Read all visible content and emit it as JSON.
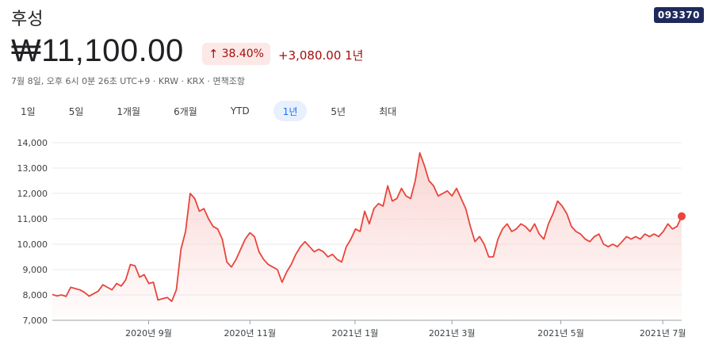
{
  "header": {
    "title": "후성",
    "ticker": "093370",
    "price": "₩11,100.00",
    "change_pct": "38.40%",
    "change_abs": "+3,080.00 1년",
    "meta": "7월 8일, 오후 6시 0분 26초 UTC+9 · KRW · KRX · 면책조항"
  },
  "ranges": [
    {
      "label": "1일",
      "active": false
    },
    {
      "label": "5일",
      "active": false
    },
    {
      "label": "1개월",
      "active": false
    },
    {
      "label": "6개월",
      "active": false
    },
    {
      "label": "YTD",
      "active": false
    },
    {
      "label": "1년",
      "active": true
    },
    {
      "label": "5년",
      "active": false
    },
    {
      "label": "최대",
      "active": false
    }
  ],
  "colors": {
    "line": "#e8453c",
    "fill": "#f9d3d0",
    "grid": "#e8eaed"
  },
  "chart_data": {
    "type": "area",
    "ylim": [
      7000,
      14000
    ],
    "yticks": [
      "14,000",
      "13,000",
      "12,000",
      "11,000",
      "10,000",
      "9,000",
      "8,000",
      "7,000"
    ],
    "ytick_values": [
      14000,
      13000,
      12000,
      11000,
      10000,
      9000,
      8000,
      7000
    ],
    "xticks": [
      {
        "label": "2020년 9월",
        "pos": 0.153
      },
      {
        "label": "2020년 11월",
        "pos": 0.314
      },
      {
        "label": "2021년 1월",
        "pos": 0.481
      },
      {
        "label": "2021년 3월",
        "pos": 0.635
      },
      {
        "label": "2021년 5월",
        "pos": 0.808
      },
      {
        "label": "2021년 7월",
        "pos": 0.97
      }
    ],
    "values": [
      8020,
      7960,
      8000,
      7940,
      8300,
      8250,
      8200,
      8100,
      7950,
      8050,
      8150,
      8400,
      8300,
      8200,
      8450,
      8350,
      8600,
      9200,
      9150,
      8700,
      8800,
      8450,
      8500,
      7800,
      7850,
      7900,
      7750,
      8200,
      9800,
      10500,
      12000,
      11800,
      11300,
      11400,
      11000,
      10700,
      10600,
      10200,
      9300,
      9100,
      9400,
      9800,
      10200,
      10450,
      10300,
      9700,
      9400,
      9200,
      9100,
      9000,
      8500,
      8900,
      9200,
      9600,
      9900,
      10100,
      9900,
      9700,
      9800,
      9700,
      9500,
      9600,
      9400,
      9300,
      9900,
      10200,
      10600,
      10500,
      11300,
      10800,
      11400,
      11600,
      11500,
      12300,
      11700,
      11800,
      12200,
      11900,
      11800,
      12500,
      13600,
      13100,
      12500,
      12300,
      11900,
      12000,
      12100,
      11900,
      12200,
      11800,
      11400,
      10700,
      10100,
      10300,
      10000,
      9500,
      9500,
      10200,
      10600,
      10800,
      10500,
      10600,
      10800,
      10700,
      10500,
      10800,
      10400,
      10200,
      10800,
      11200,
      11700,
      11500,
      11200,
      10700,
      10500,
      10400,
      10200,
      10100,
      10300,
      10400,
      10000,
      9900,
      10000,
      9900,
      10100,
      10300,
      10200,
      10300,
      10200,
      10400,
      10300,
      10400,
      10300,
      10500,
      10800,
      10600,
      10700,
      11100
    ]
  }
}
